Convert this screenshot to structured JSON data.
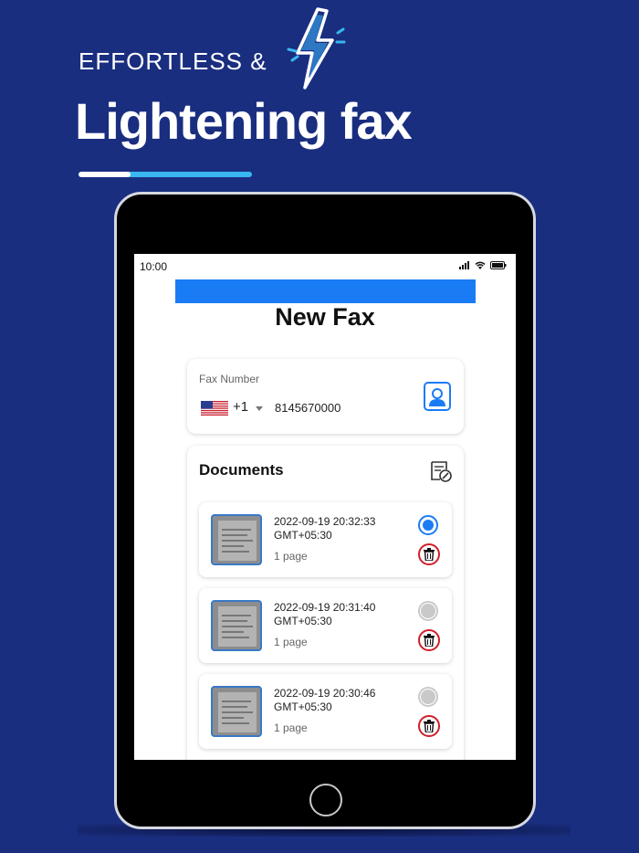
{
  "hero": {
    "subtitle": "EFFORTLESS &",
    "title": "Lightening fax",
    "progress": 0.3
  },
  "status_bar": {
    "time": "10:00",
    "icons": [
      "signal-icon",
      "wifi-icon",
      "battery-icon"
    ]
  },
  "app": {
    "title": "New Fax",
    "accent_color": "#1a7cf5"
  },
  "fax": {
    "label": "Fax Number",
    "country_flag": "us-flag-icon",
    "country_code": "+1",
    "number": "8145670000"
  },
  "documents": {
    "title": "Documents",
    "items": [
      {
        "date": "2022-09-19 20:32:33",
        "timezone": "GMT+05:30",
        "pages": "1 page",
        "selected": true
      },
      {
        "date": "2022-09-19 20:31:40",
        "timezone": "GMT+05:30",
        "pages": "1 page",
        "selected": false
      },
      {
        "date": "2022-09-19 20:30:46",
        "timezone": "GMT+05:30",
        "pages": "1 page",
        "selected": false
      }
    ]
  }
}
